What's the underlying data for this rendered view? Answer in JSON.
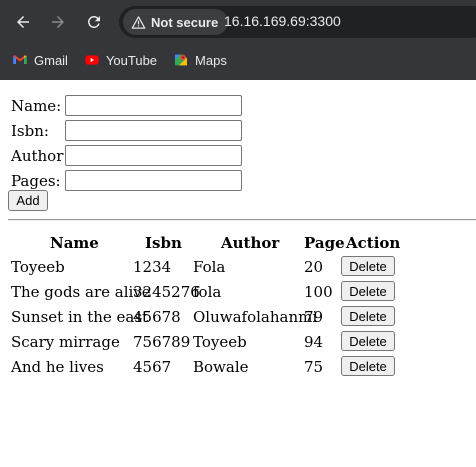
{
  "browser": {
    "security_label": "Not secure",
    "url": "16.16.169.69:3300",
    "bookmarks": [
      {
        "label": "Gmail",
        "icon": "gmail-icon"
      },
      {
        "label": "YouTube",
        "icon": "youtube-icon"
      },
      {
        "label": "Maps",
        "icon": "maps-icon"
      }
    ]
  },
  "form": {
    "name_label": "Name:",
    "isbn_label": "Isbn:",
    "author_label": "Author:",
    "pages_label": "Pages:",
    "name_value": "",
    "isbn_value": "",
    "author_value": "",
    "pages_value": "",
    "add_label": "Add"
  },
  "table": {
    "headers": [
      "Name",
      "Isbn",
      "Author",
      "Page",
      "Action"
    ],
    "rows": [
      {
        "name": "Toyeeb",
        "isbn": "1234",
        "author": "Fola",
        "page": "20",
        "action": "Delete"
      },
      {
        "name": "The gods are alive",
        "isbn": "3245276",
        "author": "fola",
        "page": "100",
        "action": "Delete"
      },
      {
        "name": "Sunset in the east",
        "isbn": "45678",
        "author": "Oluwafolahanmi",
        "page": "79",
        "action": "Delete"
      },
      {
        "name": "Scary mirrage",
        "isbn": "756789",
        "author": "Toyeeb",
        "page": "94",
        "action": "Delete"
      },
      {
        "name": "And he lives",
        "isbn": "4567",
        "author": "Bowale",
        "page": "75",
        "action": "Delete"
      }
    ]
  },
  "colors": {
    "chrome_bg": "#35363a",
    "omnibox_bg": "#202124",
    "chrome_text": "#e8eaed",
    "page_bg": "#ffffff"
  }
}
